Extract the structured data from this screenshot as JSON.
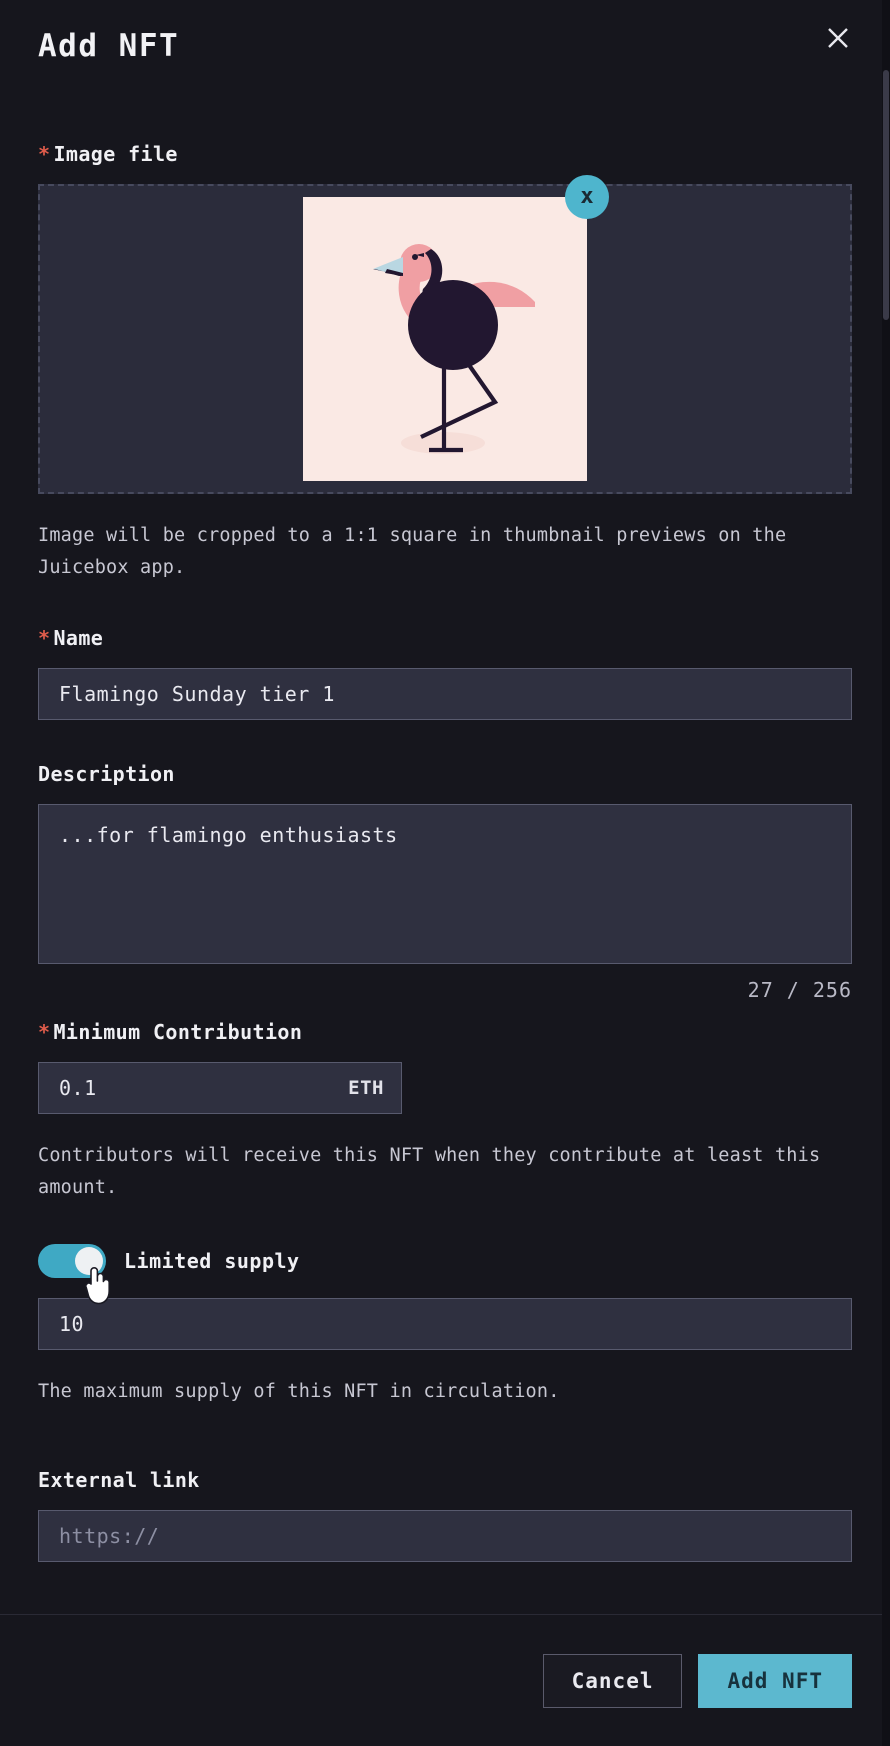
{
  "dialog": {
    "title": "Add NFT",
    "close_icon": "close-x-icon"
  },
  "image_file": {
    "label": "Image file",
    "required_marker": "*",
    "remove_icon": "x-icon",
    "remove_label": "x",
    "help": "Image will be cropped to a 1:1 square in thumbnail previews on the Juicebox app.",
    "artwork_alt": "flamingo-illustration"
  },
  "name": {
    "label": "Name",
    "required_marker": "*",
    "value": "Flamingo Sunday tier 1",
    "placeholder": ""
  },
  "description": {
    "label": "Description",
    "value": "...for flamingo enthusiasts",
    "placeholder": "",
    "counter": "27 / 256",
    "count": 27,
    "max": 256
  },
  "minimum_contribution": {
    "label": "Minimum Contribution",
    "required_marker": "*",
    "value": "0.1",
    "suffix": "ETH",
    "help": "Contributors will receive this NFT when they contribute at least this amount."
  },
  "limited_supply": {
    "label": "Limited supply",
    "enabled": true,
    "supply_value": "10",
    "supply_placeholder": "",
    "help": "The maximum supply of this NFT in circulation."
  },
  "external_link": {
    "label": "External link",
    "value": "",
    "placeholder": "https://"
  },
  "footer": {
    "cancel_label": "Cancel",
    "submit_label": "Add NFT"
  },
  "colors": {
    "accent": "#5cb8cf",
    "toggle_on": "#3fa9c4",
    "required_star": "#e05c4b",
    "dialog_bg": "#16161d",
    "input_bg": "#2f3040",
    "dropzone_bg": "#2b2c3b"
  }
}
